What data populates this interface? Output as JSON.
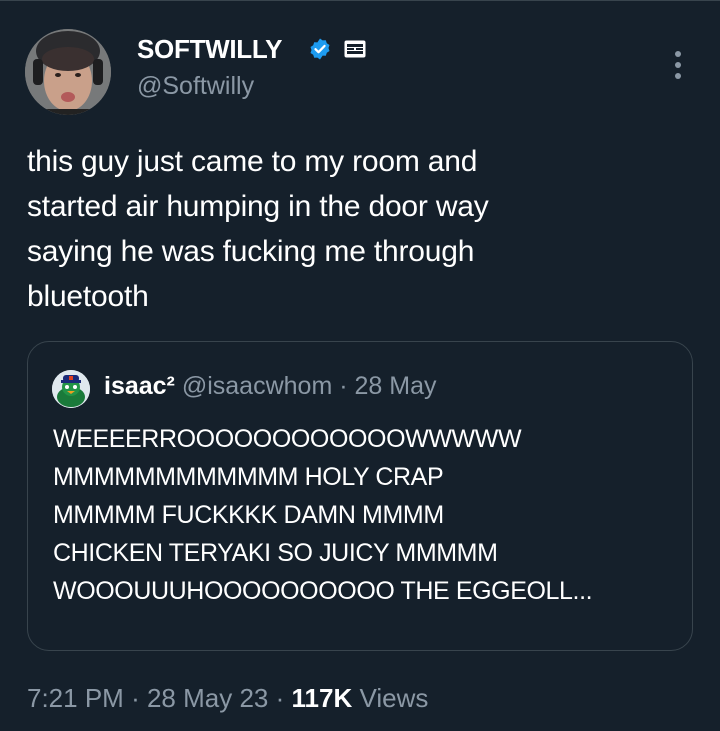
{
  "author": {
    "display_name": "SOFTWILLY",
    "handle": "@Softwilly",
    "verified_icon": "verified-badge-icon",
    "affiliate_icon": "sg-badge-icon"
  },
  "tweet": {
    "lines": [
      "this guy just came to my room and",
      "started air humping in the door way",
      "saying he was fucking me through",
      "bluetooth"
    ]
  },
  "quote": {
    "display_name": "isaac²",
    "handle": "@isaacwhom",
    "separator": "·",
    "date": "28 May",
    "lines": [
      "WEEEERROOOOOOOOOOOOWWWWW",
      "MMMMMMMMMMMM HOLY CRAP",
      "MMMMM FUCKKKK DAMN MMMM",
      "CHICKEN TERYAKI SO JUICY MMMMM",
      "WOOOUUUHOOOOOOOOOO THE EGGEOLL..."
    ]
  },
  "footer": {
    "time": "7:21 PM",
    "sep1": "·",
    "date": "28 May 23",
    "sep2": "·",
    "views_count": "117K",
    "views_label": "Views"
  },
  "colors": {
    "background": "#15202b",
    "border": "#38444d",
    "secondary_text": "#8b98a5",
    "verified_blue": "#1d9bf0"
  }
}
